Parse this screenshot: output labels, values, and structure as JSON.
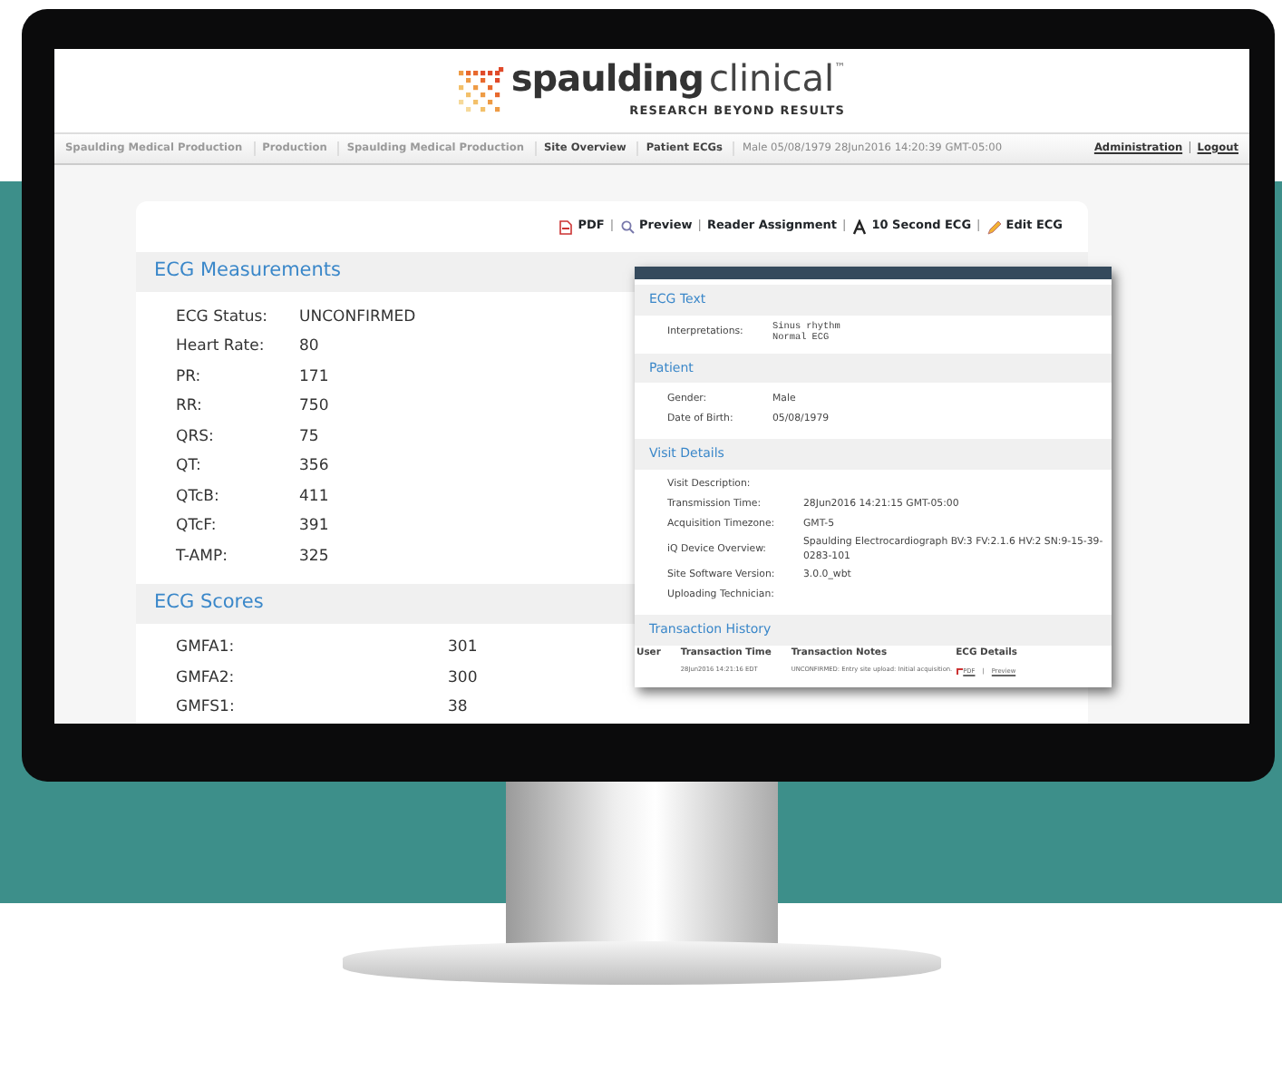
{
  "logo": {
    "name_bold": "spaulding",
    "name_light": "clinical",
    "mark": "™",
    "tagline": "RESEARCH BEYOND RESULTS"
  },
  "breadcrumbs": [
    {
      "label": "Spaulding Medical Production",
      "active": false
    },
    {
      "label": "Production",
      "active": false
    },
    {
      "label": "Spaulding Medical Production",
      "active": false
    },
    {
      "label": "Site Overview",
      "active": true
    },
    {
      "label": "Patient ECGs",
      "active": true
    }
  ],
  "patient_summary": "Male 05/08/1979 28Jun2016 14:20:39 GMT-05:00",
  "user_links": {
    "items": [
      "Administration",
      "Logout"
    ],
    "separator": "|"
  },
  "toolbar": {
    "separator": "|",
    "links": [
      {
        "label": "PDF",
        "kind": "pdf"
      },
      {
        "label": "Preview",
        "kind": "search"
      },
      {
        "label": "Reader Assignment",
        "kind": "plain"
      },
      {
        "label": "10 Second ECG",
        "kind": "letter"
      },
      {
        "label": "Edit ECG",
        "kind": "pencil"
      }
    ]
  },
  "sections": [
    {
      "title": "ECG Measurements",
      "kind": "narrow",
      "rows": [
        {
          "label": "ECG Status:",
          "value": "UNCONFIRMED"
        },
        {
          "label": "Heart Rate:",
          "value": "80"
        },
        {
          "label": "PR:",
          "value": "171"
        },
        {
          "label": "RR:",
          "value": "750"
        },
        {
          "label": "QRS:",
          "value": "75"
        },
        {
          "label": "QT:",
          "value": "356"
        },
        {
          "label": "QTcB:",
          "value": "411"
        },
        {
          "label": "QTcF:",
          "value": "391"
        },
        {
          "label": "T-AMP:",
          "value": "325"
        }
      ]
    },
    {
      "title": "ECG Scores",
      "kind": "wide",
      "rows": [
        {
          "label": "GMFA1:",
          "value": "301"
        },
        {
          "label": "GMFA2:",
          "value": "300"
        },
        {
          "label": "GMFS1:",
          "value": "38"
        }
      ]
    }
  ],
  "popup": {
    "sections": [
      {
        "title": "ECG Text",
        "kind": "mono",
        "rows": [
          {
            "label": "Interpretations:",
            "value": "Sinus rhythm\nNormal ECG"
          }
        ]
      },
      {
        "title": "Patient",
        "kind": "short",
        "rows": [
          {
            "label": "Gender:",
            "value": "Male"
          },
          {
            "label": "Date of Birth:",
            "value": "05/08/1979"
          }
        ]
      },
      {
        "title": "Visit Details",
        "kind": "long",
        "rows": [
          {
            "label": "Visit Description:"
          },
          {
            "label": "Transmission Time:",
            "value": "28Jun2016 14:21:15 GMT-05:00"
          },
          {
            "label": "Acquisition Timezone:",
            "value": "GMT-5"
          },
          {
            "label": "iQ Device Overview:",
            "value": "Spaulding Electrocardiograph BV:3 FV:2.1.6 HV:2 SN:9-15-39-0283-101"
          },
          {
            "label": "Site Software Version:",
            "value": "3.0.0_wbt"
          },
          {
            "label": "Uploading Technician:"
          }
        ]
      }
    ],
    "history": {
      "title": "Transaction History",
      "columns": [
        "User",
        "Transaction Time",
        "Transaction Notes",
        "ECG Details"
      ],
      "rows": [
        {
          "time": "28Jun2016 14:21:16 EDT",
          "notes": "UNCONFIRMED: Entry site upload: Initial acquisition.",
          "links": [
            "PDF",
            "Preview"
          ],
          "separator": "|"
        }
      ]
    }
  }
}
